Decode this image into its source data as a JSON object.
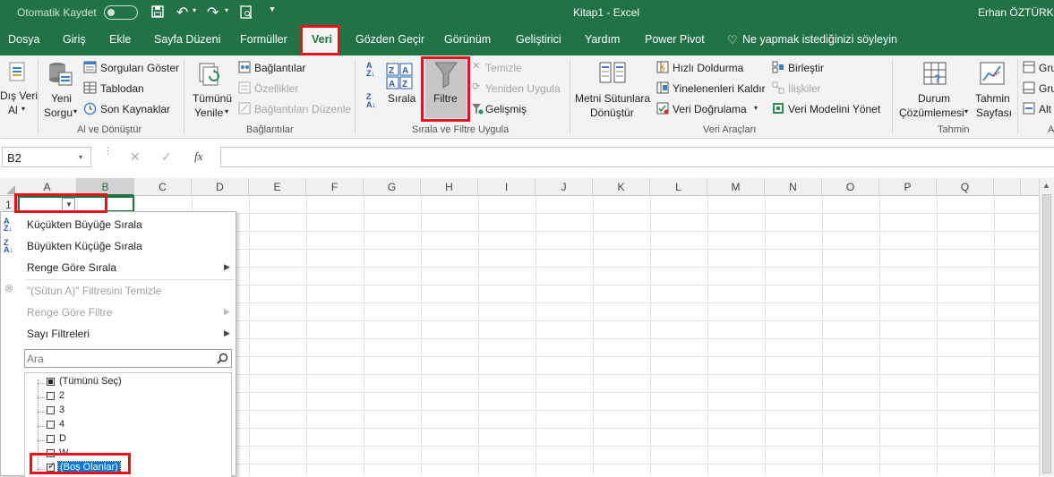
{
  "titlebar": {
    "autosave": "Otomatik Kaydet",
    "doc_title": "Kitap1  -  Excel",
    "user": "Erhan ÖZTÜRK"
  },
  "tabs": [
    "Dosya",
    "Giriş",
    "Ekle",
    "Sayfa Düzeni",
    "Formüller",
    "Veri",
    "Gözden Geçir",
    "Görünüm",
    "Geliştirici",
    "Yardım",
    "Power Pivot"
  ],
  "tell_me": "Ne yapmak istediğinizi söyleyin",
  "ribbon": {
    "dis_veri": [
      "Dış Veri",
      "Al"
    ],
    "yeni_sorgu": [
      "Yeni",
      "Sorgu"
    ],
    "sorgulari": "Sorguları Göster",
    "tablodan": "Tablodan",
    "son_kaynaklar": "Son Kaynaklar",
    "grp_al": "Al ve Dönüştür",
    "tumunu_yenile": [
      "Tümünü",
      "Yenile"
    ],
    "baglantilar": "Bağlantılar",
    "ozellikler": "Özellikler",
    "baglantilari_duzenle": "Bağlantıları Düzenle",
    "grp_baglantilar": "Bağlantılar",
    "sirala": "Sırala",
    "filtre": "Filtre",
    "temizle": "Temizle",
    "yeniden_uygula": "Yeniden Uygula",
    "gelismis": "Gelişmiş",
    "grp_sirala": "Sırala ve Filtre Uygula",
    "metni": [
      "Metni Sütunlara",
      "Dönüştür"
    ],
    "hizli": "Hızlı Doldurma",
    "yinelenenleri": "Yinelenenleri Kaldır",
    "veri_dogrulama": "Veri Doğrulama",
    "birlestir": "Birleştir",
    "iliskiler": "İlişkiler",
    "veri_modeli": "Veri Modelini Yönet",
    "grp_veri_araclari": "Veri Araçları",
    "durum": [
      "Durum",
      "Çözümlemesi"
    ],
    "tahmin": [
      "Tahmin",
      "Sayfası"
    ],
    "grp_tahmin": "Tahmin",
    "gru1": "Gru",
    "gru2": "Gru",
    "alt": "Alt",
    "grp_cut": "A"
  },
  "formula_bar": {
    "namebox": "B2",
    "fx": "fx",
    "value": ""
  },
  "columns": [
    "A",
    "B",
    "C",
    "D",
    "E",
    "F",
    "G",
    "H",
    "I",
    "J",
    "K",
    "L",
    "M",
    "N",
    "O",
    "P",
    "Q"
  ],
  "row_number": "1",
  "menu": {
    "sort_asc": "Küçükten Büyüğe Sırala",
    "sort_desc": "Büyükten Küçüğe Sırala",
    "sort_color": "Renge Göre Sırala",
    "clear_filter": "\"(Sütun A)\" Filtresini Temizle",
    "filter_color": "Renge Göre Filtre",
    "number_filters": "Sayı Filtreleri",
    "search_placeholder": "Ara",
    "items": [
      {
        "label": "(Tümünü Seç)",
        "state": "partial"
      },
      {
        "label": "2",
        "state": "unchecked"
      },
      {
        "label": "3",
        "state": "unchecked"
      },
      {
        "label": "4",
        "state": "unchecked"
      },
      {
        "label": "D",
        "state": "unchecked"
      },
      {
        "label": "W",
        "state": "unchecked"
      },
      {
        "label": "(Boş Olanlar)",
        "state": "checked"
      }
    ]
  },
  "colors": {
    "excel_green": "#217346",
    "highlight_red": "#e3131b",
    "selection_blue": "#0078d7"
  }
}
